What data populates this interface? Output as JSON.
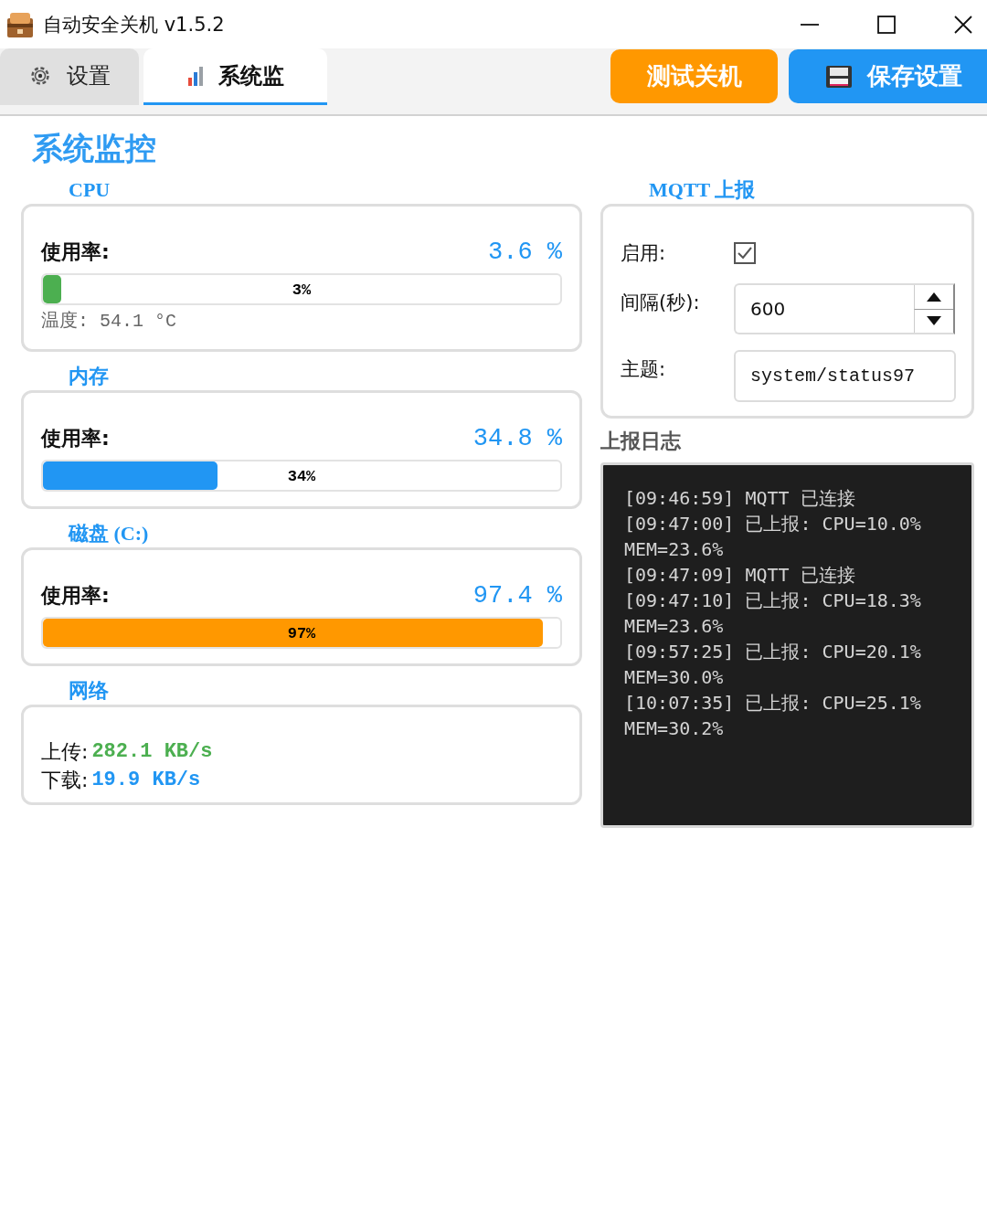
{
  "window": {
    "title": "自动安全关机 v1.5.2"
  },
  "tabs": [
    {
      "label": "设置",
      "selected": false
    },
    {
      "label": "系统监",
      "selected": true
    }
  ],
  "actions": [
    {
      "label": "测试关机",
      "kind": "warning"
    },
    {
      "label": "保存设置",
      "kind": "primary"
    }
  ],
  "page_title": "系统监控",
  "monitors": [
    {
      "kind": "usage",
      "title": "CPU",
      "label": "使用率:",
      "value": "3.6 %",
      "level": 0.036,
      "bar_text": "3%",
      "color": "#4caf50",
      "detail": "温度: 54.1 °C"
    },
    {
      "kind": "usage",
      "title": "内存",
      "label": "使用率:",
      "value": "34.8 %",
      "level": 0.338,
      "bar_text": "34%",
      "color": "#2196f3"
    },
    {
      "kind": "usage",
      "title": "磁盘 (C:)",
      "label": "使用率:",
      "value": "97.4 %",
      "level": 0.967,
      "bar_text": "97%",
      "color": "#ff9800"
    },
    {
      "kind": "network",
      "title": "网络",
      "rows": [
        {
          "label": "上传:",
          "value": "282.1 KB/s",
          "color": "#4caf50"
        },
        {
          "label": "下载:",
          "value": "19.9 KB/s",
          "color": "#2196f3"
        }
      ]
    }
  ],
  "mqtt": {
    "title": "MQTT 上报",
    "fields": [
      {
        "kind": "checkbox",
        "label": "启用:",
        "checked": true
      },
      {
        "kind": "spinbox",
        "label": "间隔(秒):",
        "value": "600"
      },
      {
        "kind": "text",
        "label": "主题:",
        "value": "system/status97"
      }
    ]
  },
  "log": {
    "title": "上报日志",
    "entries": [
      "[09:46:59] MQTT 已连接",
      "[09:47:00] 已上报: CPU=10.0% MEM=23.6%",
      "[09:47:09] MQTT 已连接",
      "[09:47:10] 已上报: CPU=18.3% MEM=23.6%",
      "[09:57:25] 已上报: CPU=20.1% MEM=30.0%",
      "[10:07:35] 已上报: CPU=25.1% MEM=30.2%"
    ]
  }
}
